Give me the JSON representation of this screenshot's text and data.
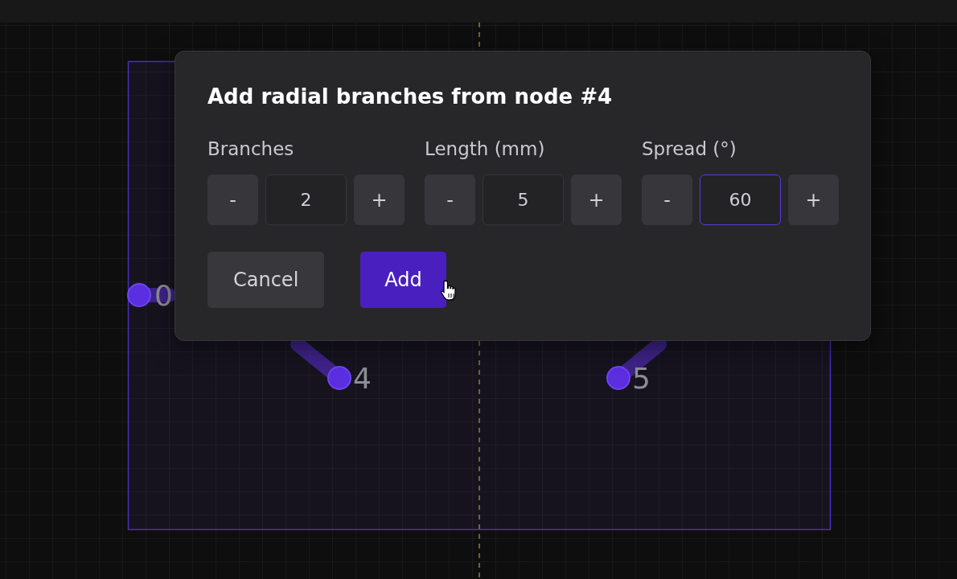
{
  "canvas": {
    "nodes": [
      {
        "label": "0"
      },
      {
        "label": "4"
      },
      {
        "label": "5"
      }
    ]
  },
  "dialog": {
    "title": "Add radial branches from node #4",
    "fields": [
      {
        "label": "Branches",
        "decrement": "-",
        "value": "2",
        "increment": "+",
        "focused": false
      },
      {
        "label": "Length (mm)",
        "decrement": "-",
        "value": "5",
        "increment": "+",
        "focused": false
      },
      {
        "label": "Spread (°)",
        "decrement": "-",
        "value": "60",
        "increment": "+",
        "focused": true
      }
    ],
    "buttons": [
      {
        "label": "Cancel",
        "kind": "secondary"
      },
      {
        "label": "Add",
        "kind": "primary"
      }
    ]
  }
}
